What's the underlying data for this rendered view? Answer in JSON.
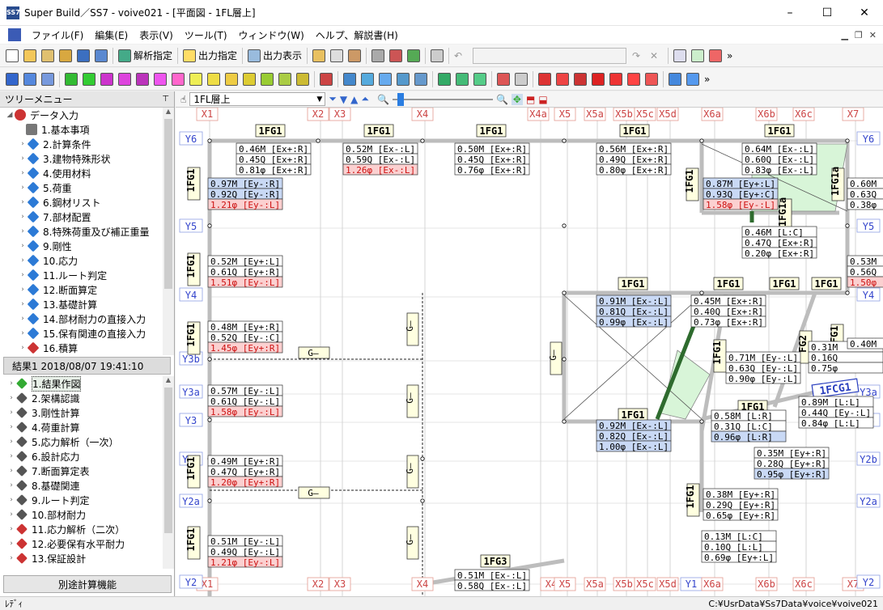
{
  "window": {
    "title": "Super Build／SS7 - voive021 - [平面図 - 1FL層上]",
    "minimize": "–",
    "maximize": "☐",
    "close": "✕"
  },
  "menu": [
    "ファイル(F)",
    "編集(E)",
    "表示(V)",
    "ツール(T)",
    "ウィンドウ(W)",
    "ヘルプ、解説書(H)"
  ],
  "toolbar": {
    "analysis_label": "解析指定",
    "output_label": "出力指定",
    "display_label": "出力表示"
  },
  "view": {
    "floor_select": "1FL層上",
    "zoom_percent": 5
  },
  "tree_panel": {
    "title": "ツリーメニュー",
    "root": "データ入力",
    "items": [
      "1.基本事項",
      "2.計算条件",
      "3.建物特殊形状",
      "4.使用材料",
      "5.荷重",
      "6.鋼材リスト",
      "7.部材配置",
      "8.特殊荷重及び補正重量",
      "9.剛性",
      "10.応力",
      "11.ルート判定",
      "12.断面算定",
      "13.基礎計算",
      "14.部材耐力の直接入力",
      "15.保有関連の直接入力",
      "16.積算"
    ]
  },
  "result_panel": {
    "title": "結果1  2018/08/07 19:41:10",
    "items": [
      "1.結果作図",
      "2.架構認識",
      "3.剛性計算",
      "4.荷重計算",
      "5.応力解析（一次）",
      "6.設計応力",
      "7.断面算定表",
      "8.基礎関連",
      "9.ルート判定",
      "10.部材耐力",
      "11.応力解析（二次）",
      "12.必要保有水平耐力",
      "13.保証設計"
    ],
    "separate_button": "別途計算機能"
  },
  "status": {
    "left": "ﾚﾃﾞｨ",
    "path": "C:¥UsrData¥Ss7Data¥voice¥voive021"
  },
  "plan": {
    "x_axes": [
      "X1",
      "X2",
      "X3",
      "X4",
      "X4a",
      "X5",
      "X5a",
      "X5b",
      "X5c",
      "X5d",
      "X6a",
      "X6b",
      "X6c",
      "X7"
    ],
    "x_axes_bottom": [
      "X1",
      "X2",
      "X3",
      "X4",
      "X4",
      "X5",
      "X5a",
      "X5b",
      "X5c",
      "X5d",
      "Y1",
      "X6a",
      "X6b",
      "X6c",
      "X7"
    ],
    "y_axes_left": [
      "Y6",
      "Y5",
      "Y4",
      "Y3b",
      "Y3a",
      "Y3",
      "Y2b",
      "Y2a",
      "Y2"
    ],
    "y_axes_right": [
      "Y6",
      "Y5",
      "Y4",
      "Y3b",
      "Y3a",
      "Y3",
      "Y2b",
      "Y2a",
      "Y2"
    ],
    "beams": [
      "1FG1",
      "1FG1",
      "1FG1",
      "1FG1",
      "1FG1",
      "1FG1",
      "1FG1",
      "1FG1",
      "1FG1",
      "1FG1",
      "1FG1",
      "1FG1",
      "1FG1",
      "1FG1",
      "1FG1",
      "1FG1",
      "1FG1a",
      "1FG1a",
      "1FG1",
      "1FG3",
      "G—",
      "G—",
      "G—",
      "G—",
      "G—",
      "G—",
      "G—",
      "G—",
      "1FG1",
      "FG2",
      "1FG1",
      "1FG1"
    ],
    "special_beam": "1FCG1",
    "stress_boxes": [
      [
        "0.46M [Ex+:R]",
        "0.45Q [Ex+:R]",
        "0.81φ [Ex+:R]"
      ],
      [
        "0.52M [Ex-:L]",
        "0.59Q [Ex-:L]",
        "1.26φ [Ex-:L]"
      ],
      [
        "0.50M [Ex+:R]",
        "0.45Q [Ex+:R]",
        "0.76φ [Ex+:R]"
      ],
      [
        "0.56M [Ex+:R]",
        "0.49Q [Ex+:R]",
        "0.80φ [Ex+:R]"
      ],
      [
        "0.64M [Ex-:L]",
        "0.60Q [Ex-:L]",
        "0.83φ [Ex-:L]"
      ],
      [
        "0.97M [Ey-:R]",
        "0.92Q [Ey-:R]",
        "1.21φ [Ey-:L]"
      ],
      [
        "0.87M [Ey+:L]",
        "0.93Q [Ey+:C]",
        "1.58φ [Ey-:L]"
      ],
      [
        "0.60M",
        "0.63Q",
        "0.38φ"
      ],
      [
        "0.46M [L:C]",
        "0.47Q [Ex+:R]",
        "0.20φ [Ex+:R]"
      ],
      [
        "0.52M [Ey+:L]",
        "0.61Q [Ey+:R]",
        "1.51φ [Ey-:L]"
      ],
      [
        "0.53M",
        "0.56Q",
        "1.50φ"
      ],
      [
        "0.91M [Ex-:L]",
        "0.81Q [Ex-:L]",
        "0.99φ [Ex-:L]"
      ],
      [
        "0.45M [Ex+:R]",
        "0.40Q [Ex+:R]",
        "0.73φ [Ex+:R]"
      ],
      [
        "0.48M [Ey+:R]",
        "0.52Q [Ey-:C]",
        "1.45φ [Ey+:R]"
      ],
      [
        "0.71M [Ey-:L]",
        "0.63Q [Ey-:L]",
        "0.90φ [Ey-:L]"
      ],
      [
        "0.31M",
        "0.16Q",
        "0.75φ"
      ],
      [
        "0.40M",
        "",
        ""
      ],
      [
        "0.57M [Ey-:L]",
        "0.61Q [Ey-:L]",
        "1.58φ [Ey-:L]"
      ],
      [
        "0.89M [L:L]",
        "0.44Q [Ey-:L]",
        "0.84φ [L:L]"
      ],
      [
        "0.92M [Ex-:L]",
        "0.82Q [Ex-:L]",
        "1.00φ [Ex-:L]"
      ],
      [
        "0.58M [L:R]",
        "0.31Q [L:C]",
        "0.96φ [L:R]"
      ],
      [
        "0.49M [Ey+:R]",
        "0.47Q [Ey+:R]",
        "1.20φ [Ey+:R]"
      ],
      [
        "0.35M [Ey+:R]",
        "0.28Q [Ey+:R]",
        "0.95φ [Ey+:R]"
      ],
      [
        "0.38M [Ey+:R]",
        "0.29Q [Ey+:R]",
        "0.65φ [Ey+:R]"
      ],
      [
        "0.51M [Ey-:L]",
        "0.49Q [Ey-:L]",
        "1.21φ [Ey-:L]"
      ],
      [
        "0.13M [L:C]",
        "0.10Q [L:L]",
        "0.69φ [Ey+:L]"
      ],
      [
        "0.51M [Ex-:L]",
        "0.58Q [Ex-:L]",
        ""
      ]
    ]
  }
}
